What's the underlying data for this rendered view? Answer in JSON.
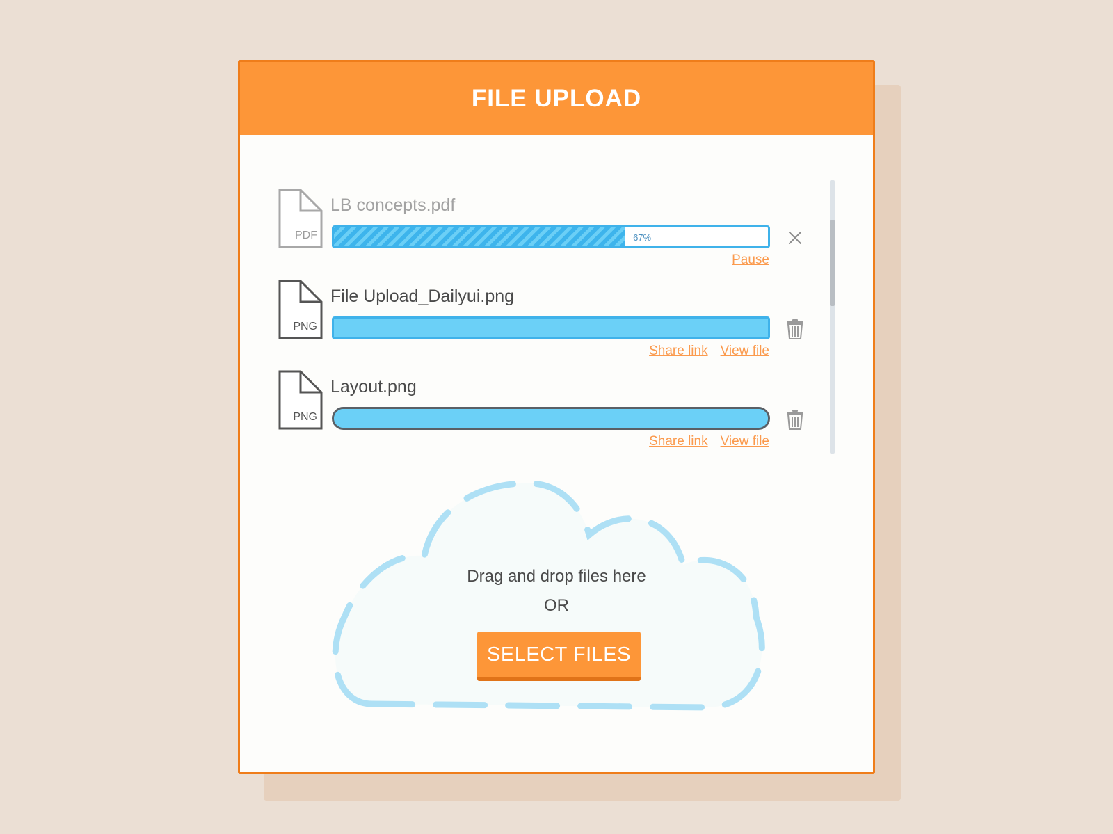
{
  "header": {
    "title": "FILE UPLOAD"
  },
  "files": [
    {
      "name": "LB concepts.pdf",
      "ext": "PDF",
      "status": "uploading",
      "progress": 0.67,
      "progress_label": "67%",
      "action_icon": "close-icon",
      "links": [
        "Pause"
      ]
    },
    {
      "name": "File Upload_Dailyui.png",
      "ext": "PNG",
      "status": "complete",
      "progress": 1.0,
      "action_icon": "trash-icon",
      "links": [
        "Share link",
        "View file"
      ]
    },
    {
      "name": "Layout.png",
      "ext": "PNG",
      "status": "complete",
      "progress": 1.0,
      "action_icon": "trash-icon",
      "links": [
        "Share link",
        "View file"
      ]
    }
  ],
  "dropzone": {
    "text": "Drag and drop files here",
    "or_text": "OR",
    "button_label": "SELECT FILES"
  },
  "colors": {
    "accent": "#fd9638",
    "accent_border": "#ef7d1a",
    "progress_blue": "#6bd0f7",
    "progress_stripe": "#3db4ec",
    "link_orange": "#fb9a4d",
    "cloud_dash": "#aee0f5"
  }
}
